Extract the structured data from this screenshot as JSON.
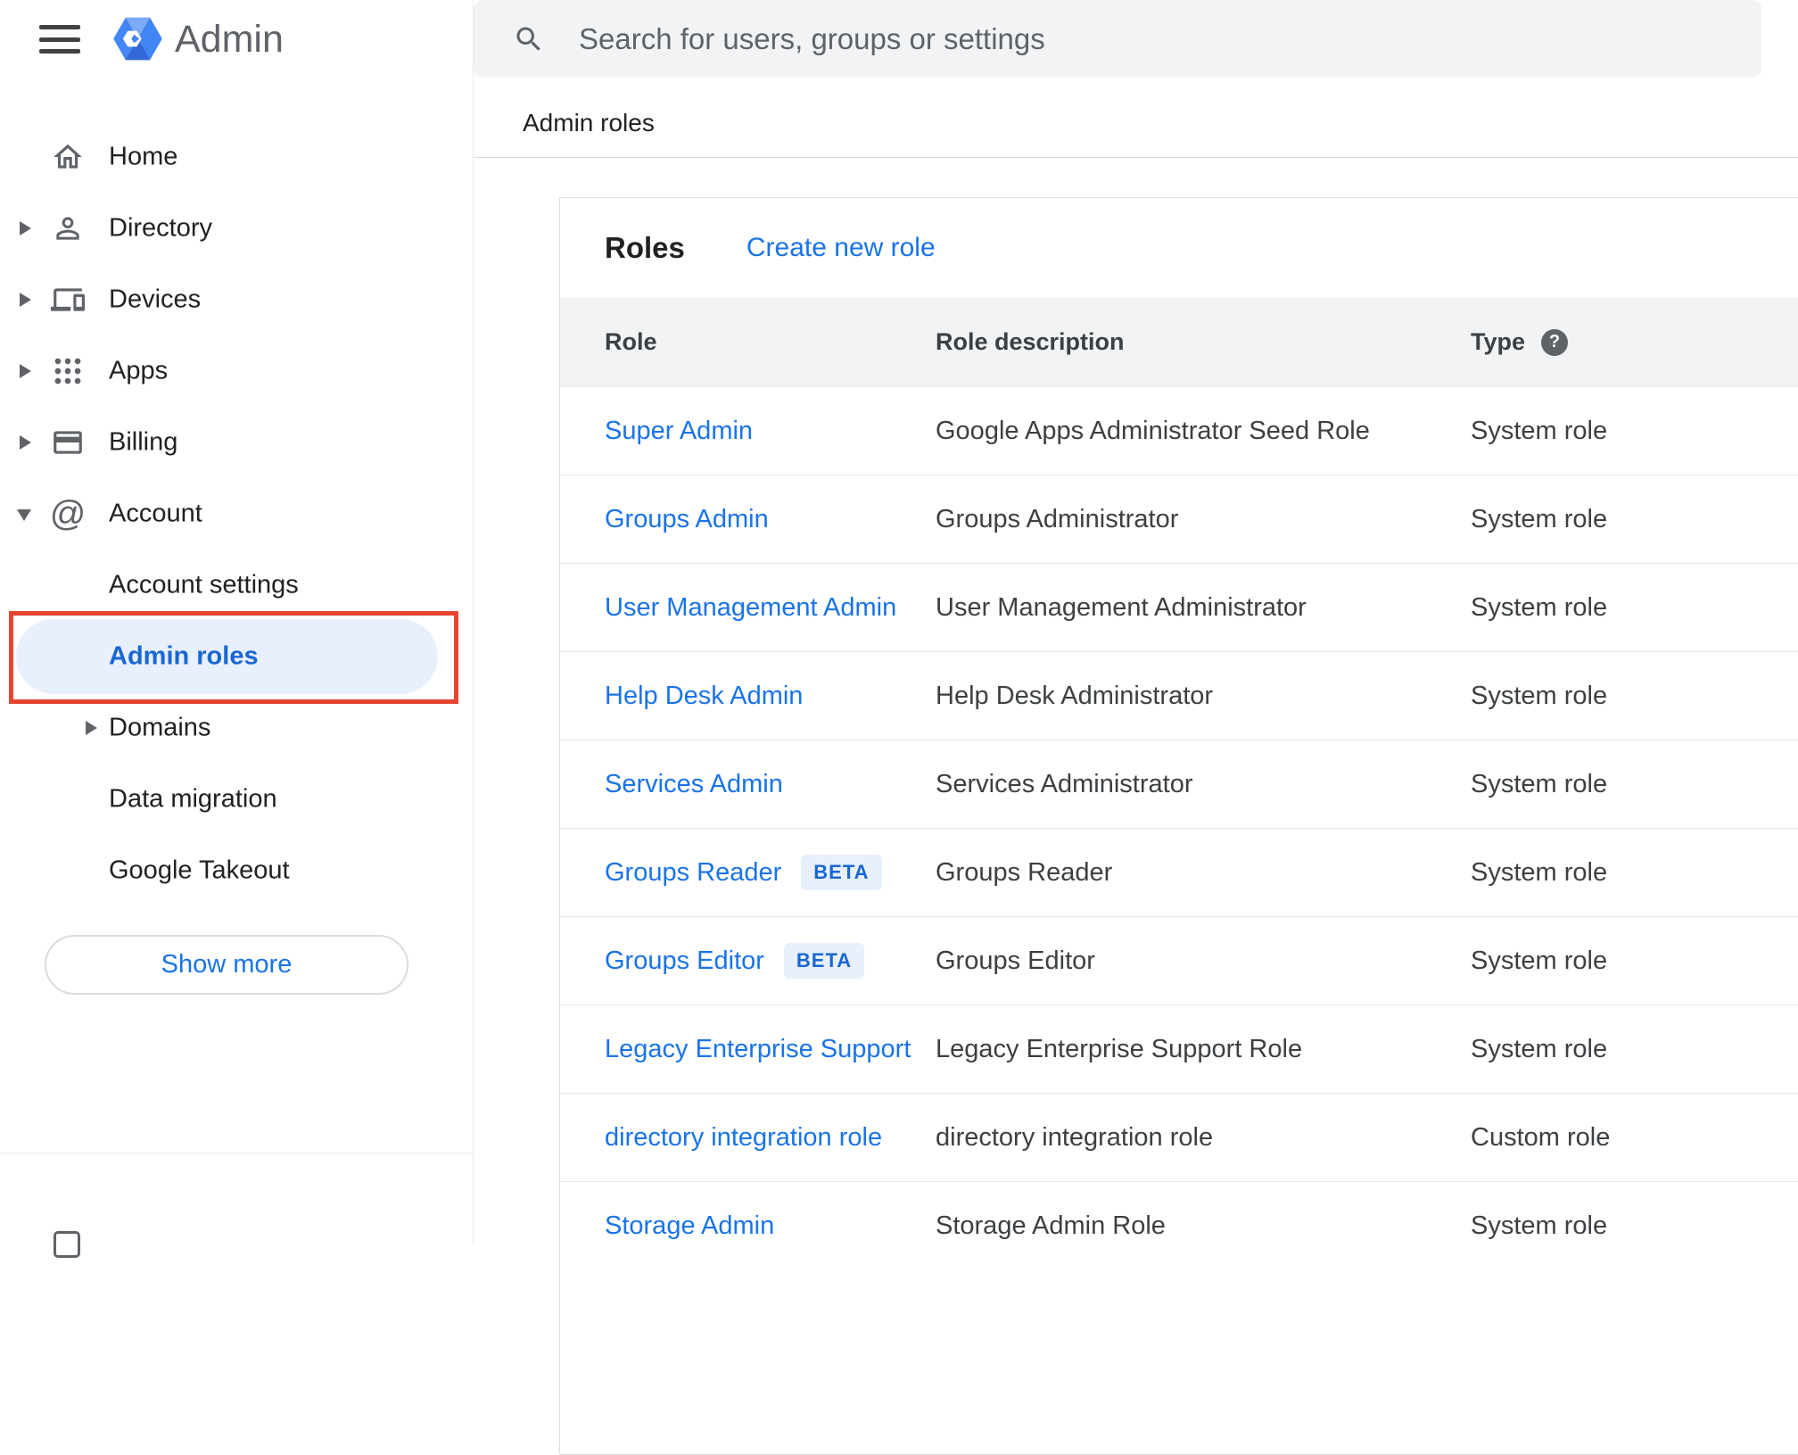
{
  "topbar": {
    "app_name": "Admin",
    "search_placeholder": "Search for users, groups or settings"
  },
  "breadcrumb": "Admin roles",
  "sidebar": {
    "items": [
      {
        "label": "Home"
      },
      {
        "label": "Directory"
      },
      {
        "label": "Devices"
      },
      {
        "label": "Apps"
      },
      {
        "label": "Billing"
      },
      {
        "label": "Account"
      },
      {
        "label": "Account settings"
      },
      {
        "label": "Admin roles",
        "selected": true
      },
      {
        "label": "Domains"
      },
      {
        "label": "Data migration"
      },
      {
        "label": "Google Takeout"
      }
    ],
    "show_more_label": "Show more"
  },
  "main": {
    "roles_title": "Roles",
    "create_new_role": "Create new role",
    "table": {
      "headers": {
        "role": "Role",
        "description": "Role description",
        "type": "Type"
      },
      "help_glyph": "?",
      "beta_label": "BETA",
      "rows": [
        {
          "role": "Super Admin",
          "description": "Google Apps Administrator Seed Role",
          "type": "System role"
        },
        {
          "role": "Groups Admin",
          "description": "Groups Administrator",
          "type": "System role"
        },
        {
          "role": "User Management Admin",
          "description": "User Management Administrator",
          "type": "System role"
        },
        {
          "role": "Help Desk Admin",
          "description": "Help Desk Administrator",
          "type": "System role"
        },
        {
          "role": "Services Admin",
          "description": "Services Administrator",
          "type": "System role"
        },
        {
          "role": "Groups Reader",
          "beta": true,
          "description": "Groups Reader",
          "type": "System role"
        },
        {
          "role": "Groups Editor",
          "beta": true,
          "description": "Groups Editor",
          "type": "System role"
        },
        {
          "role": "Legacy Enterprise Support",
          "description": "Legacy Enterprise Support Role",
          "type": "System role"
        },
        {
          "role": "directory integration role",
          "description": "directory integration role",
          "type": "Custom role"
        },
        {
          "role": "Storage Admin",
          "description": "Storage Admin Role",
          "type": "System role"
        }
      ]
    }
  },
  "colors": {
    "accent_blue": "#1a73e8",
    "selected_text_blue": "#1967d2",
    "selected_bg": "#e8f0fe",
    "annotation_red": "#e8432f",
    "searchbar_bg": "#f1f3f4"
  }
}
